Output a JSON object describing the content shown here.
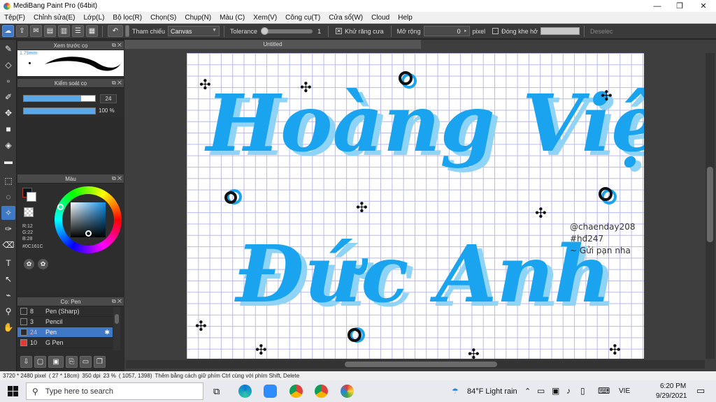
{
  "window": {
    "title": "MediBang Paint Pro (64bit)",
    "minimize": "—",
    "restore": "❐",
    "close": "✕"
  },
  "menu": [
    "Tệp(F)",
    "Chỉnh sửa(E)",
    "Lớp(L)",
    "Bộ lọc(R)",
    "Chọn(S)",
    "Chụp(N)",
    "Màu (C)",
    "Xem(V)",
    "Công cụ(T)",
    "Cửa sổ(W)",
    "Cloud",
    "Help"
  ],
  "toolbar": {
    "undo_icon": "↶",
    "reference_label": "Tham chiếu",
    "reference_value": "Canvas",
    "tolerance_label": "Tolerance",
    "tolerance_value": "1",
    "antialias_label": "Khử răng cưa",
    "antialias_checked": "✕",
    "expand_label": "Mở rộng",
    "expand_value": "0",
    "expand_unit": "pixel",
    "close_gap_label": "Đóng khe hở",
    "deselect_label": "Deselec"
  },
  "document": {
    "tab_title": "Untitled"
  },
  "panels": {
    "preview": {
      "title": "Xem trước cọ",
      "size_label": "1.79mm"
    },
    "brush_control": {
      "title": "Kiểm soát cọ",
      "size_value": "24",
      "opacity_value": "100 %",
      "size_fraction": 0.8,
      "opacity_fraction": 1.0
    },
    "color": {
      "title": "Màu",
      "r": "R:12",
      "g": "G:22",
      "b": "B:28",
      "hex": "#0C161C",
      "fg_color": "#0C161C",
      "bg_color": "#ffffff"
    },
    "brush": {
      "title": "Cọ: Pen",
      "items": [
        {
          "size": "8",
          "name": "Pen (Sharp)",
          "color": "#2d2d2d"
        },
        {
          "size": "3",
          "name": "Pencil",
          "color": "#2d2d2d"
        },
        {
          "size": "24",
          "name": "Pen",
          "color": "#2d2d2d",
          "selected": true
        },
        {
          "size": "10",
          "name": "G Pen",
          "color": "#e53935"
        }
      ]
    }
  },
  "canvas": {
    "line1": "Hoàng Việt",
    "line2": "Đức Anh",
    "lettering_color": "#1aa3ee",
    "shadow_color": "#8fd3f7",
    "watermark": [
      "@chaenday208",
      "#hđ247",
      "~ Gửi pạn nha"
    ]
  },
  "status": {
    "dimensions": "3720 * 2480 pixel",
    "cm": "( 27 * 18cm)",
    "dpi": "350 dpi",
    "zoom": "23 %",
    "coords": "( 1057, 1398)",
    "hint": "Thêm bằng cách giữ phím Ctrl cùng với phím Shift, Delete"
  },
  "taskbar": {
    "search_placeholder": "Type here to search",
    "weather": "84°F  Light rain",
    "lang": "VIE",
    "time": "6:20 PM",
    "date": "9/29/2021"
  }
}
